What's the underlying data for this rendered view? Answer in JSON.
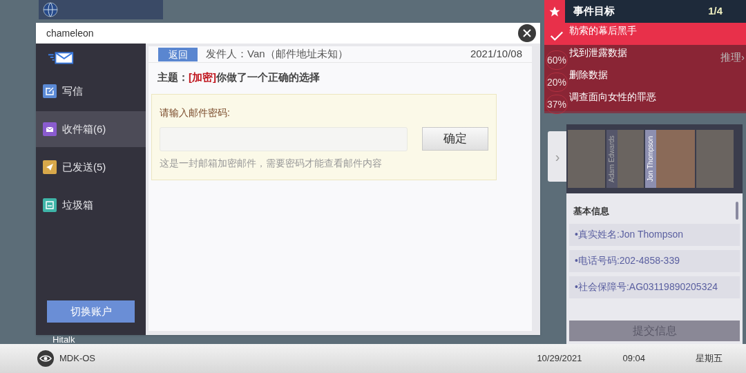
{
  "desktop": {
    "icon_label": "Hitalk"
  },
  "mail_window": {
    "title": "chameleon",
    "sidebar": [
      {
        "label": "写信",
        "kind": "compose",
        "selected": false
      },
      {
        "label": "收件箱(6)",
        "kind": "inbox",
        "selected": true
      },
      {
        "label": "已发送(5)",
        "kind": "sent",
        "selected": false
      },
      {
        "label": "垃圾箱",
        "kind": "trash",
        "selected": false
      }
    ],
    "switch_account": "切换账户",
    "back": "返回",
    "sender": "发件人：Van（邮件地址未知）",
    "date": "2021/10/08",
    "subject": "主题：**[加密]**你做了一个正确的选择",
    "password_prompt": "请输入邮件密码:",
    "confirm": "确定",
    "hint": "这是一封邮箱加密邮件，需要密码才能查看邮件内容"
  },
  "objectives": {
    "title": "事件目标",
    "count": "1/4",
    "link": "推理›",
    "items": [
      {
        "label": "勒索的幕后黑手",
        "kind": "done"
      },
      {
        "label": "找到泄露数据",
        "kind": "progress",
        "progress": "60%"
      },
      {
        "label": "删除数据",
        "kind": "progress",
        "progress": "20%"
      },
      {
        "label": "调查面向女性的罪恶",
        "kind": "progress",
        "progress": "37%"
      }
    ]
  },
  "profile": {
    "expand": "›",
    "portraits": [
      {
        "selected": false
      },
      {
        "label": "Adam Edwards",
        "selected": false
      },
      {
        "label": "Jon Thompson",
        "selected": true
      },
      {
        "selected": false
      }
    ],
    "section": "基本信息",
    "fields": [
      "•真实姓名:Jon Thompson",
      "•电话号码:202-4858-339",
      "•社会保障号:AG03119890205324"
    ],
    "submit": "提交信息"
  },
  "taskbar": {
    "os": "MDK-OS",
    "date": "10/29/2021",
    "time": "09:04",
    "weekday": "星期五"
  }
}
